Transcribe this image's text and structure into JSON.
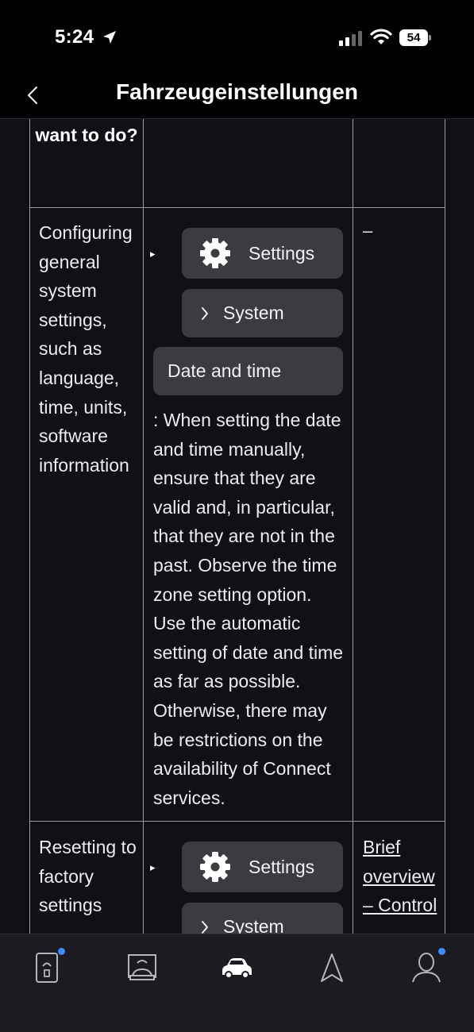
{
  "status_bar": {
    "time": "5:24",
    "battery": "54"
  },
  "nav": {
    "title": "Fahrzeugeinstellungen"
  },
  "table": {
    "header_fragment": "want to do?",
    "rows": [
      {
        "task": "Configuring general system settings, such as language, time, units, software information",
        "steps": {
          "step1": "Settings",
          "step2": "System",
          "step3": "Date and time"
        },
        "note": ": When setting the date and time manually, ensure that they are valid and, in particular, that they are not in the past. Observe the time zone setting option. Use the automatic setting of date and time as far as possible. Otherwise, there may be restrictions on the availability of Connect services.",
        "reference": "–"
      },
      {
        "task": "Resetting to factory settings",
        "steps": {
          "step1": "Settings",
          "step2": "System"
        },
        "reference": "Brief overview – Control"
      }
    ]
  },
  "tab_bar": {
    "tabs": [
      {
        "icon": "vehicle-key-icon",
        "badge": true
      },
      {
        "icon": "car-service-icon",
        "badge": false
      },
      {
        "icon": "car-icon",
        "active": true,
        "badge": false
      },
      {
        "icon": "navigation-icon",
        "badge": false
      },
      {
        "icon": "profile-icon",
        "badge": true
      }
    ]
  },
  "colors": {
    "background": "#101017",
    "pill": "#3b3b42",
    "badge": "#3a8dff",
    "grid": "#9a9aa0"
  }
}
